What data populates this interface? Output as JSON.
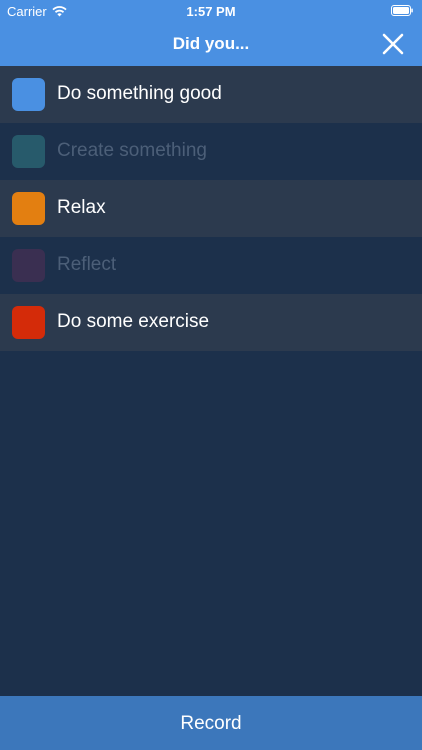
{
  "status_bar": {
    "carrier": "Carrier",
    "time": "1:57 PM"
  },
  "nav": {
    "title": "Did you...",
    "close_icon": "close-icon"
  },
  "activities": [
    {
      "label": "Do something good",
      "color": "#4a90e2",
      "selected": true
    },
    {
      "label": "Create something",
      "color": "#275a6b",
      "selected": false
    },
    {
      "label": "Relax",
      "color": "#e37f11",
      "selected": true
    },
    {
      "label": "Reflect",
      "color": "#3a2f51",
      "selected": false
    },
    {
      "label": "Do some exercise",
      "color": "#d42b09",
      "selected": true
    }
  ],
  "footer": {
    "record_label": "Record"
  }
}
